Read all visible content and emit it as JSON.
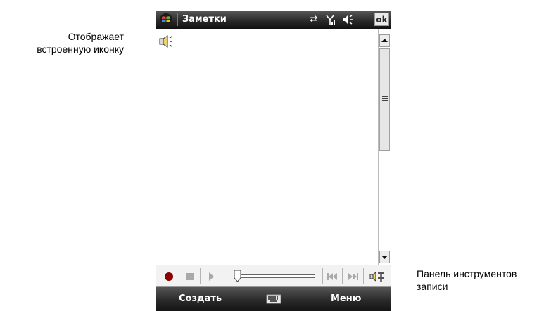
{
  "callouts": {
    "embedded_icon": {
      "line1": "Отображает",
      "line2": "встроенную иконку"
    },
    "toolbar": {
      "line1": "Панель инструментов",
      "line2": "записи"
    }
  },
  "titlebar": {
    "title": "Заметки",
    "ok_label": "ok",
    "icons": [
      "start-icon",
      "connectivity-icon",
      "signal-icon",
      "volume-icon"
    ]
  },
  "recording_toolbar": {
    "buttons": [
      "record-icon",
      "stop-icon",
      "play-icon",
      "skip-back-icon",
      "skip-forward-icon",
      "recording-toolbar-toggle-icon"
    ],
    "record_color": "#8b0000",
    "position": 0
  },
  "softkeys": {
    "left": "Создать",
    "right": "Меню",
    "center_icon": "keyboard-icon"
  },
  "colors": {
    "bar_dark": "#2a2a2a",
    "record": "#8b0000"
  }
}
